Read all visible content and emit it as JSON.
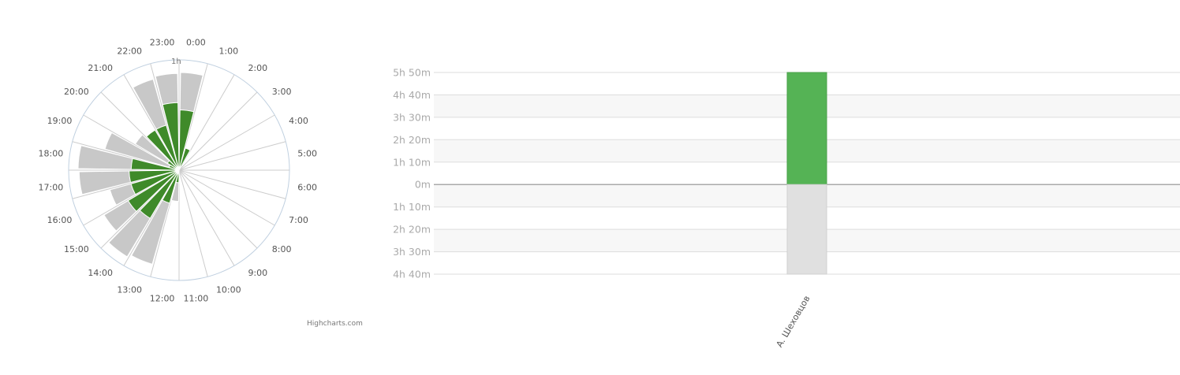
{
  "credits": "Highcharts.com",
  "colors": {
    "green_dark": "#3f8a2a",
    "green_light": "#55b355",
    "gray_bar": "#c8c8c8",
    "gray_light": "#e0e0e0",
    "grid": "#cccccc",
    "band": "#f7f7f7",
    "axis_text": "#aaaaaa"
  },
  "chart_data": [
    {
      "type": "polar-column",
      "categories": [
        "0:00",
        "1:00",
        "2:00",
        "3:00",
        "4:00",
        "5:00",
        "6:00",
        "7:00",
        "8:00",
        "9:00",
        "10:00",
        "11:00",
        "12:00",
        "13:00",
        "14:00",
        "15:00",
        "16:00",
        "17:00",
        "18:00",
        "19:00",
        "20:00",
        "21:00",
        "22:00",
        "23:00"
      ],
      "radial_axis_label": "1h",
      "radial_max_hours": 1.0,
      "series": [
        {
          "color": "gray",
          "values": [
            0.94,
            0,
            0,
            0,
            0,
            0,
            0,
            0,
            0,
            0,
            0,
            0,
            0.3,
            0.94,
            0.97,
            0.84,
            0.69,
            0.96,
            0.97,
            0.74,
            0.49,
            0.44,
            0.91,
            0.93
          ]
        },
        {
          "color": "green",
          "values": [
            0.58,
            0.22,
            0,
            0,
            0,
            0,
            0,
            0,
            0,
            0,
            0,
            0,
            0.12,
            0.33,
            0.54,
            0.57,
            0.48,
            0.48,
            0.46,
            0.1,
            0.13,
            0.45,
            0.45,
            0.65
          ]
        }
      ]
    },
    {
      "type": "bar",
      "categories": [
        "А. Шеховцов"
      ],
      "y_ticks": [
        "5h 50m",
        "4h 40m",
        "3h 30m",
        "2h 20m",
        "1h 10m",
        "0m",
        "1h 10m",
        "2h 20m",
        "3h 30m",
        "4h 40m"
      ],
      "ylim_minutes": [
        -280,
        350
      ],
      "series": [
        {
          "color": "green",
          "values_minutes": [
            350
          ]
        },
        {
          "color": "gray",
          "values_minutes": [
            -280
          ]
        }
      ]
    }
  ]
}
